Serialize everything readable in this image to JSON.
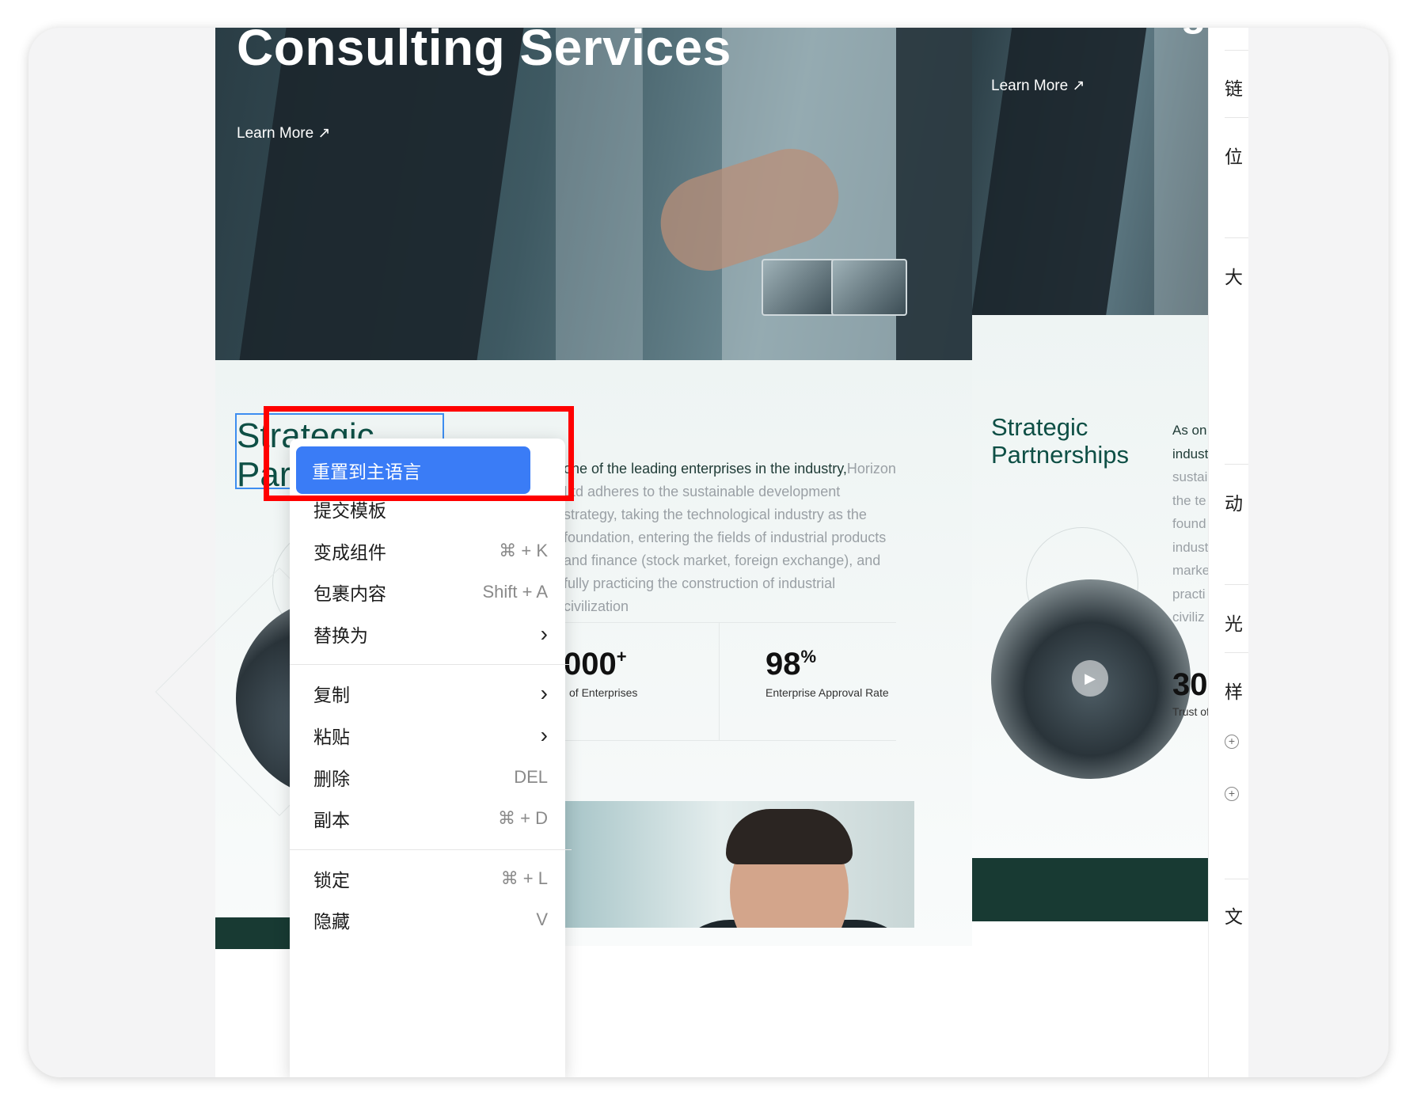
{
  "artboard_main": {
    "hero": {
      "title": "Consulting Services",
      "learn_more": "Learn More",
      "learn_more_icon": "arrow-up-right-icon"
    },
    "section": {
      "title": "Strategic Partnerships",
      "paragraph_lead": "one of the leading enterprises in the industry,",
      "paragraph_rest": "Horizon Ltd adheres to the sustainable development strategy, taking the technological industry as the foundation, entering the fields of industrial products and finance (stock market, foreign exchange), and fully practicing the construction of industrial civilization",
      "stats": [
        {
          "value": "000",
          "suffix": "+",
          "label": "of Enterprises"
        },
        {
          "value": "98",
          "suffix": "%",
          "label": "Enterprise Approval Rate"
        }
      ]
    }
  },
  "artboard_secondary": {
    "hero": {
      "title": "Consulting Serv",
      "learn_more": "Learn More"
    },
    "section": {
      "title": "Strategic Partnerships",
      "paragraph_lines": [
        "As on",
        "indust",
        "sustai",
        "the te",
        "found",
        "indust",
        "marke",
        "practi",
        "civiliz"
      ],
      "stat_value": "30",
      "stat_label": "Trust of"
    }
  },
  "properties_panel": {
    "labels": [
      "链",
      "位",
      "大",
      "动",
      "光",
      "样",
      "文"
    ]
  },
  "context_menu": {
    "items": [
      {
        "label": "重置到主语言",
        "shortcut": "",
        "submenu": false,
        "active": true
      },
      {
        "label": "提交模板",
        "shortcut": "",
        "submenu": false
      },
      {
        "label": "变成组件",
        "shortcut": "⌘ + K",
        "submenu": false
      },
      {
        "label": "包裹内容",
        "shortcut": "Shift + A",
        "submenu": false
      },
      {
        "label": "替换为",
        "shortcut": "",
        "submenu": true
      },
      {
        "label": "复制",
        "shortcut": "",
        "submenu": true
      },
      {
        "label": "粘贴",
        "shortcut": "",
        "submenu": true
      },
      {
        "label": "删除",
        "shortcut": "DEL",
        "submenu": false
      },
      {
        "label": "副本",
        "shortcut": "⌘ + D",
        "submenu": false
      },
      {
        "label": "锁定",
        "shortcut": "⌘ + L",
        "submenu": false
      },
      {
        "label": "隐藏",
        "shortcut": "V",
        "submenu": false
      }
    ]
  },
  "colors": {
    "accent": "#3a7cf6",
    "highlight_box": "#ff0000",
    "brand_green": "#0e4f45",
    "dark_green": "#183a33",
    "selection": "#3d8df0"
  }
}
